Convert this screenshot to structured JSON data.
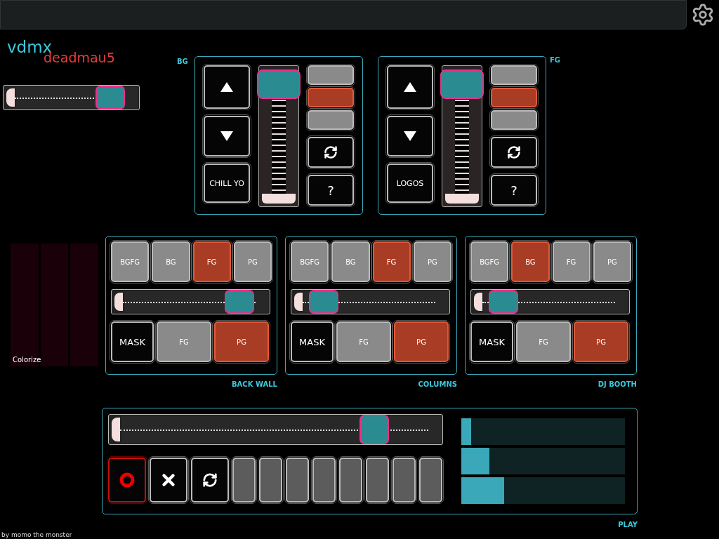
{
  "logo": {
    "primary": "vdmx",
    "secondary": "deadmau5"
  },
  "master_slider": {
    "level": 0.86
  },
  "layers": [
    {
      "label": "BG",
      "preset": "CHILL YO",
      "fader": {
        "level": 0.97
      },
      "toggles": [
        {
          "selected": false
        },
        {
          "selected": true
        },
        {
          "selected": false
        }
      ],
      "help": "?"
    },
    {
      "label": "FG",
      "preset": "LOGOS",
      "fader": {
        "level": 0.97
      },
      "toggles": [
        {
          "selected": false
        },
        {
          "selected": true
        },
        {
          "selected": false
        }
      ],
      "help": "?"
    }
  ],
  "colorize": {
    "label": "Colorize"
  },
  "zones": [
    {
      "label": "BACK WALL",
      "sources": [
        {
          "label": "BGFG",
          "selected": false
        },
        {
          "label": "BG",
          "selected": false
        },
        {
          "label": "FG",
          "selected": true
        },
        {
          "label": "PG",
          "selected": false
        }
      ],
      "slider": {
        "level": 0.88
      },
      "outputs": [
        {
          "label": "MASK",
          "kind": "mask",
          "selected": false
        },
        {
          "label": "FG",
          "kind": "layer",
          "selected": false
        },
        {
          "label": "PG",
          "kind": "layer",
          "selected": true
        }
      ]
    },
    {
      "label": "COLUMNS",
      "sources": [
        {
          "label": "BGFG",
          "selected": false
        },
        {
          "label": "BG",
          "selected": false
        },
        {
          "label": "FG",
          "selected": true
        },
        {
          "label": "PG",
          "selected": false
        }
      ],
      "slider": {
        "level": 0.04
      },
      "outputs": [
        {
          "label": "MASK",
          "kind": "mask",
          "selected": false
        },
        {
          "label": "FG",
          "kind": "layer",
          "selected": false
        },
        {
          "label": "PG",
          "kind": "layer",
          "selected": true
        }
      ]
    },
    {
      "label": "DJ BOOTH",
      "sources": [
        {
          "label": "BGFG",
          "selected": false
        },
        {
          "label": "BG",
          "selected": true
        },
        {
          "label": "FG",
          "selected": false
        },
        {
          "label": "PG",
          "selected": false
        }
      ],
      "slider": {
        "level": 0.04
      },
      "outputs": [
        {
          "label": "MASK",
          "kind": "mask",
          "selected": false
        },
        {
          "label": "FG",
          "kind": "layer",
          "selected": false
        },
        {
          "label": "PG",
          "kind": "layer",
          "selected": true
        }
      ]
    }
  ],
  "play": {
    "label": "PLAY",
    "slider": {
      "level": 0.82
    },
    "buttons": [
      {
        "kind": "record"
      },
      {
        "kind": "clear"
      },
      {
        "kind": "refresh"
      },
      {
        "kind": "blank"
      },
      {
        "kind": "blank"
      },
      {
        "kind": "blank"
      },
      {
        "kind": "blank"
      },
      {
        "kind": "blank"
      },
      {
        "kind": "blank"
      },
      {
        "kind": "blank"
      },
      {
        "kind": "blank"
      }
    ],
    "meters": [
      {
        "level": 0.06
      },
      {
        "level": 0.17
      },
      {
        "level": 0.26
      }
    ]
  },
  "footer": "by momo the monster"
}
